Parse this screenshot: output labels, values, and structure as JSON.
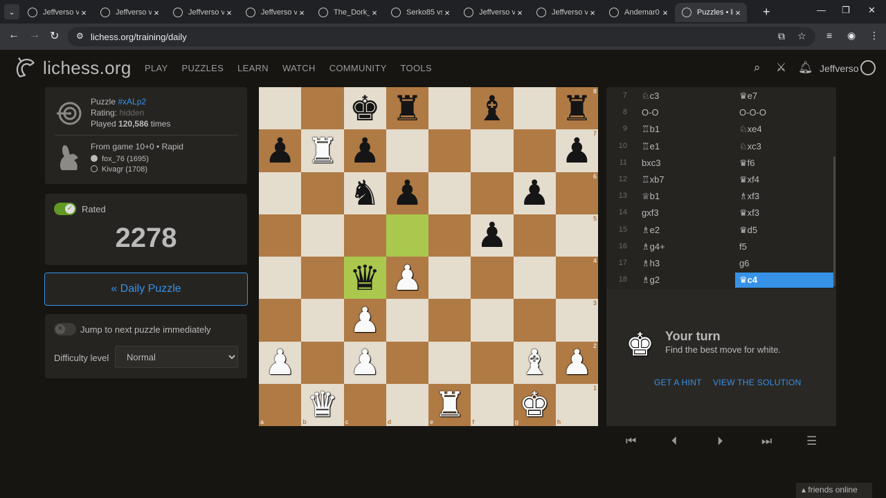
{
  "browser": {
    "tabs": [
      {
        "title": "Jeffverso v",
        "active": false
      },
      {
        "title": "Jeffverso v",
        "active": false
      },
      {
        "title": "Jeffverso v",
        "active": false
      },
      {
        "title": "Jeffverso v",
        "active": false
      },
      {
        "title": "The_Dork_",
        "active": false
      },
      {
        "title": "Serko85 vs",
        "active": false
      },
      {
        "title": "Jeffverso v",
        "active": false
      },
      {
        "title": "Jeffverso v",
        "active": false
      },
      {
        "title": "Andemar0",
        "active": false
      },
      {
        "title": "Puzzles • li",
        "active": true
      }
    ],
    "url": "lichess.org/training/daily"
  },
  "header": {
    "logo_text": "lichess.org",
    "nav": [
      "PLAY",
      "PUZZLES",
      "LEARN",
      "WATCH",
      "COMMUNITY",
      "TOOLS"
    ],
    "username": "Jeffverso"
  },
  "puzzle_info": {
    "puzzle_label": "Puzzle",
    "puzzle_id": "#xALp2",
    "rating_label": "Rating:",
    "rating_value": "hidden",
    "played_prefix": "Played",
    "played_count": "120,586",
    "played_suffix": "times",
    "game_label": "From game 10+0 • Rapid",
    "white_player": "fox_76 (1695)",
    "black_player": "Kivagr (1708)"
  },
  "rated": {
    "label": "Rated",
    "enabled": true,
    "rating": "2278"
  },
  "daily_button": "« Daily Puzzle",
  "settings": {
    "jump_label": "Jump to next puzzle immediately",
    "jump_enabled": false,
    "difficulty_label": "Difficulty level",
    "difficulty_value": "Normal"
  },
  "board": {
    "ranks": [
      "8",
      "7",
      "6",
      "5",
      "4",
      "3",
      "2",
      "1"
    ],
    "files": [
      "a",
      "b",
      "c",
      "d",
      "e",
      "f",
      "g",
      "h"
    ],
    "position": [
      [
        "",
        "",
        "bK",
        "bR",
        "",
        "bB",
        "",
        "bR"
      ],
      [
        "bP",
        "wR",
        "bP",
        "",
        "",
        "",
        "",
        "bP"
      ],
      [
        "",
        "",
        "bN",
        "bP",
        "",
        "",
        "bP",
        ""
      ],
      [
        "",
        "",
        "",
        "",
        "",
        "bP",
        "",
        ""
      ],
      [
        "",
        "",
        "bQ",
        "wP",
        "",
        "",
        "",
        ""
      ],
      [
        "",
        "",
        "wP",
        "",
        "",
        "",
        "",
        ""
      ],
      [
        "wP",
        "",
        "wP",
        "",
        "",
        "",
        "wB",
        "wP"
      ],
      [
        "",
        "wQ",
        "",
        "",
        "wR",
        "",
        "wK",
        ""
      ]
    ],
    "last_move": [
      "d5",
      "c4"
    ],
    "colors": {
      "light": "#e4dccd",
      "dark": "#b07a45",
      "highlight": "#aac84e"
    }
  },
  "moves": [
    {
      "n": "7",
      "w": "♘c3",
      "b": "♛e7"
    },
    {
      "n": "8",
      "w": "O-O",
      "b": "O-O-O"
    },
    {
      "n": "9",
      "w": "♖b1",
      "b": "♘xe4"
    },
    {
      "n": "10",
      "w": "♖e1",
      "b": "♘xc3"
    },
    {
      "n": "11",
      "w": "bxc3",
      "b": "♛f6"
    },
    {
      "n": "12",
      "w": "♖xb7",
      "b": "♛xf4"
    },
    {
      "n": "13",
      "w": "♕b1",
      "b": "♗xf3"
    },
    {
      "n": "14",
      "w": "gxf3",
      "b": "♛xf3"
    },
    {
      "n": "15",
      "w": "♗e2",
      "b": "♛d5"
    },
    {
      "n": "16",
      "w": "♗g4+",
      "b": "f5"
    },
    {
      "n": "17",
      "w": "♗h3",
      "b": "g6"
    },
    {
      "n": "18",
      "w": "♗g2",
      "b": "♛c4",
      "current": true
    }
  ],
  "turn": {
    "title": "Your turn",
    "subtitle": "Find the best move for white.",
    "hint": "GET A HINT",
    "solution": "VIEW THE SOLUTION"
  },
  "friends": "friends online",
  "accent": "#3692e7"
}
